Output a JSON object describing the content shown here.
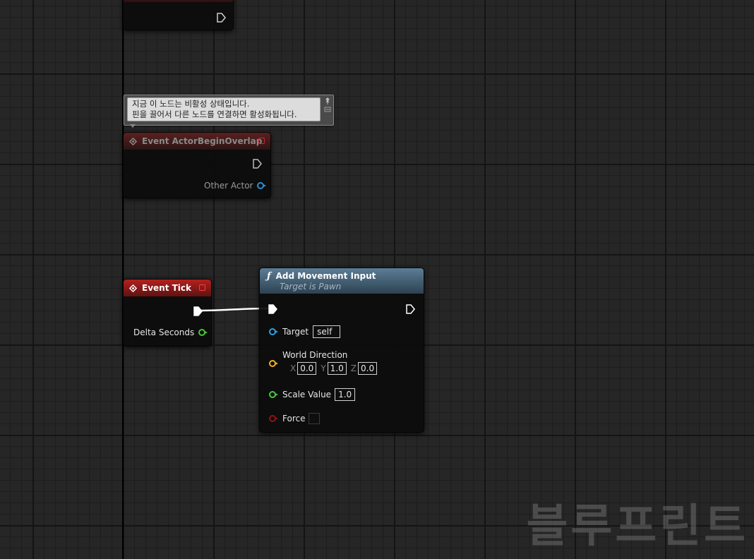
{
  "graph": {
    "watermark": "블루프린트"
  },
  "tooltip": {
    "line1": "지금 이 노드는 비활성 상태입니다.",
    "line2": "핀을 끌어서 다른 노드를 연결하면 활성화됩니다."
  },
  "nodes": {
    "overlap": {
      "title": "Event ActorBeginOverlap",
      "pin_other_actor": "Other Actor"
    },
    "tick": {
      "title": "Event Tick",
      "pin_delta": "Delta Seconds"
    },
    "add_movement": {
      "title": "Add Movement Input",
      "subtitle": "Target is Pawn",
      "pin_target": "Target",
      "target_value": "self",
      "pin_world_direction": "World Direction",
      "x_label": "X",
      "x_value": "0.0",
      "y_label": "Y",
      "y_value": "1.0",
      "z_label": "Z",
      "z_value": "0.0",
      "pin_scale": "Scale Value",
      "scale_value": "1.0",
      "pin_force": "Force",
      "force_checked": false
    }
  },
  "colors": {
    "exec": "#ffffff",
    "object_pin": "#2a9fe0",
    "vector_pin": "#f0b020",
    "float_pin": "#46c83a",
    "bool_pin": "#8c1414",
    "event_header": "#b3201f",
    "function_header": "#5c7d95"
  },
  "icons": {
    "event": "event-diamond-icon",
    "function": "function-f-icon",
    "pin": "pin-toggle-icon"
  }
}
